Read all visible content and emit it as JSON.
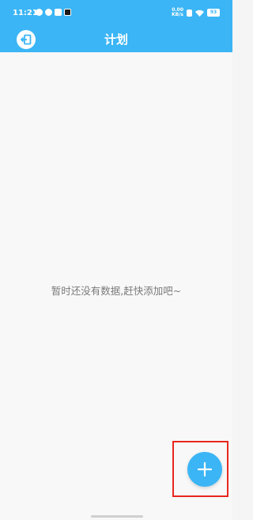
{
  "status_bar": {
    "time": "11:21",
    "net_speed_value": "0.00",
    "net_speed_unit": "KB/s",
    "battery": "93",
    "icons": [
      "sync-icon",
      "shield-icon",
      "photo-icon",
      "tiktok-icon",
      "nfc-icon",
      "wifi-icon",
      "battery-icon"
    ]
  },
  "app_bar": {
    "title": "计划",
    "back_icon": "exit-icon"
  },
  "main": {
    "empty_message": "暂时还没有数据,赶快添加吧~"
  },
  "fab": {
    "icon": "plus-icon",
    "highlight_color": "#e8271f"
  },
  "colors": {
    "primary": "#3bb5f5",
    "background": "#f8f8f8",
    "empty_text": "#7a7a7a"
  }
}
